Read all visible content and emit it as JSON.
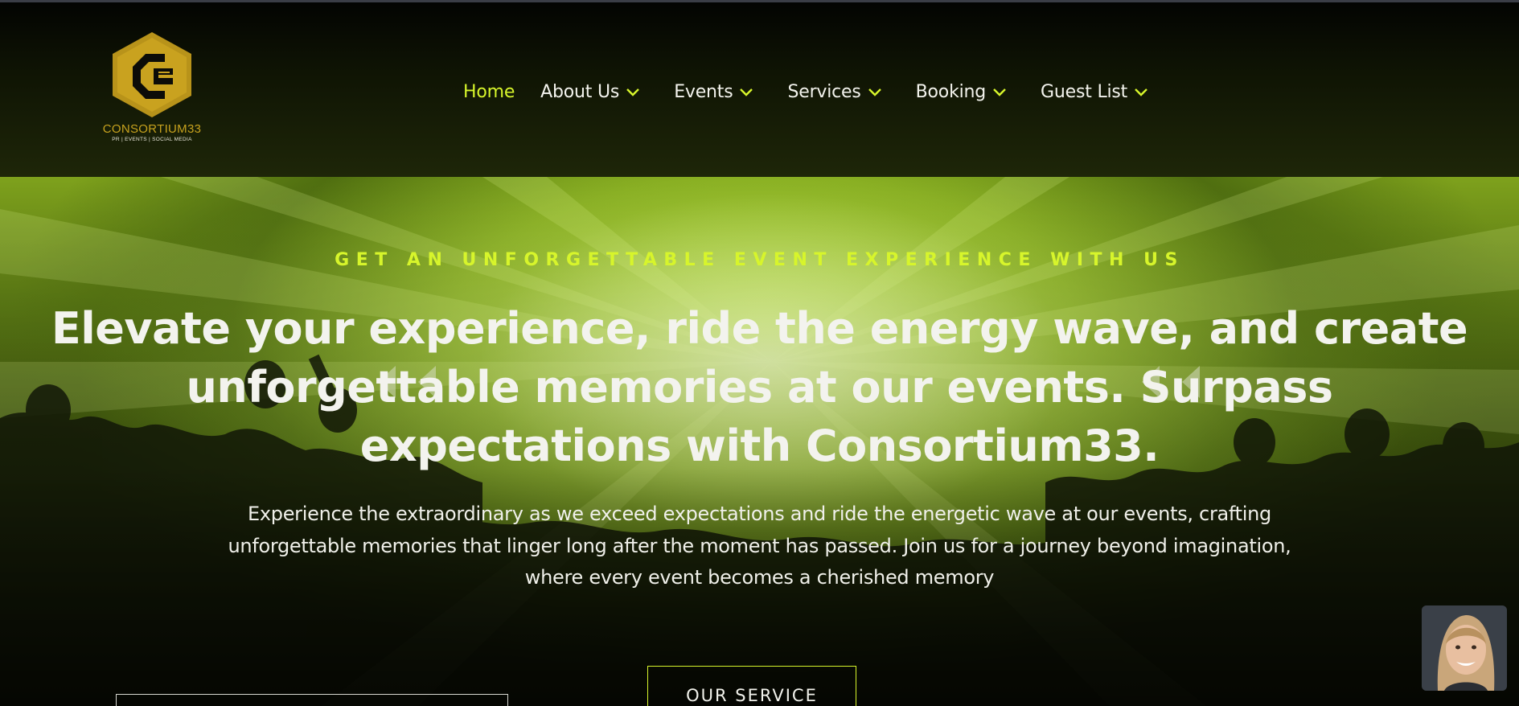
{
  "brand": {
    "name": "CONSORTIUM33",
    "tagline": "PR | EVENTS | SOCIAL MEDIA",
    "logo_color": "#c7a21e"
  },
  "nav": {
    "items": [
      {
        "label": "Home",
        "active": true,
        "dropdown": false
      },
      {
        "label": "About Us",
        "active": false,
        "dropdown": true,
        "icon": "chevron-down-icon"
      },
      {
        "label": "Events",
        "active": false,
        "dropdown": true,
        "icon": "chevron-down-icon"
      },
      {
        "label": "Services",
        "active": false,
        "dropdown": true,
        "icon": "chevron-down-icon"
      },
      {
        "label": "Booking",
        "active": false,
        "dropdown": true,
        "icon": "chevron-down-icon"
      },
      {
        "label": "Guest List",
        "active": false,
        "dropdown": true,
        "icon": "chevron-down-icon"
      }
    ]
  },
  "hero": {
    "subtitle": "GET AN UNFORGETTABLE EVENT EXPERIENCE WITH US",
    "title": "Elevate your experience, ride the energy wave, and create unforgettable memories at our events. Surpass expectations with Consortium33.",
    "text": "Experience the extraordinary as we exceed expectations and ride the energetic wave at our events, crafting unforgettable memories that linger long after the moment has passed. Join us for a journey beyond imagination, where every event becomes a cherished memory",
    "service_button": "OUR SERVICE"
  },
  "colors": {
    "accent": "#d7f52b",
    "text": "#f2f2ec",
    "header_bg": "#0f1404"
  }
}
